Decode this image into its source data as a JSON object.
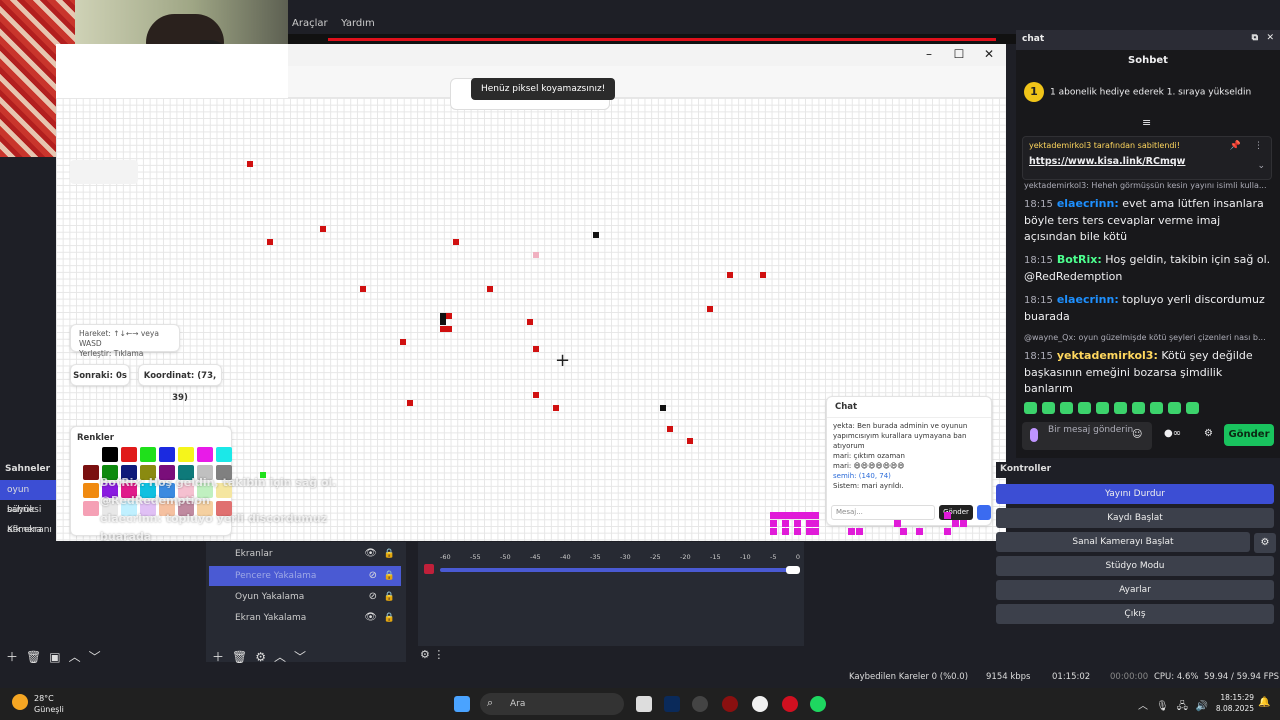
{
  "obs": {
    "menu": [
      "Araçlar",
      "Yardım"
    ],
    "scenes_title": "Sahneler",
    "scenes": [
      "oyun sahnesi",
      "büyük Kamera",
      "afk ekranı"
    ],
    "sources": [
      {
        "label": "Ekranlar",
        "visible": true
      },
      {
        "label": "Pencere Yakalama",
        "visible": false,
        "selected": true
      },
      {
        "label": "Oyun Yakalama",
        "visible": false
      },
      {
        "label": "Ekran Yakalama",
        "visible": true
      }
    ],
    "mixer_scale": [
      "-60",
      "-55",
      "-50",
      "-45",
      "-40",
      "-35",
      "-30",
      "-25",
      "-20",
      "-15",
      "-10",
      "-5",
      "0"
    ],
    "controls_title": "Kontroller",
    "controls": [
      "Yayını Durdur",
      "Kaydı Başlat",
      "Sanal Kamerayı Başlat",
      "Stüdyo Modu",
      "Ayarlar",
      "Çıkış"
    ],
    "status": {
      "dropped": "Kaybedilen Kareler 0 (%0.0)",
      "bitrate": "9154 kbps",
      "live_time": "01:15:02",
      "rec_time": "00:00:00",
      "cpu": "CPU: 4.6%",
      "fps": "59.94 / 59.94 FPS"
    }
  },
  "game": {
    "tooltip": "Henüz piksel koyamazsınız!",
    "help_line1": "Hareket: ↑↓←→ veya WASD",
    "help_line2": "Yerleştir: Tıklama",
    "cooldown": "Sonraki: 0s",
    "coordinate": "Koordinat: (73, 39)",
    "colors_title": "Renkler",
    "colors": [
      "#ffffff",
      "#000000",
      "#e01b1b",
      "#1fe01b",
      "#1b2ae0",
      "#f5f51b",
      "#e81be8",
      "#1be8e8",
      "#7a1010",
      "#0e8a0e",
      "#0e1a7a",
      "#8a8a10",
      "#7a0e7a",
      "#0e7a7a",
      "#c0c0c0",
      "#808080",
      "#f08a10",
      "#8a1be0",
      "#e01b8a",
      "#10c0e0",
      "#3b8ae0",
      "#f5c0d0",
      "#c0f0c0",
      "#f5e6a0",
      "#f5a0b5",
      "#e8e8e8",
      "#c0f0ff",
      "#e0c0f5",
      "#f5c0a0",
      "#c08aa0",
      "#f5d0a0",
      "#e07070"
    ],
    "ghost_line1": "BotRix: Hoş geldin, takibin için sağ ol.",
    "ghost_line2": "@RedRedemption",
    "ghost_line3": "elaecrinn: topluyo yerli discordumuz buarada",
    "chat_title": "Chat",
    "chat_lines": [
      "yekta: Ben burada adminin ve oyunun yapımcısıyım kurallara uymayana ban atıyorum",
      "mari: çıktım ozaman",
      "mari: 😄😄😄😄😄😄😄",
      "semih: (140, 74)",
      "Sistem: mari ayrıldı."
    ],
    "chat_placeholder": "Mesaj...",
    "chat_send": "Gönder"
  },
  "twitch": {
    "dock_title": "chat",
    "header": "Sohbet",
    "gift_num": "1",
    "gift_text": "1 abonelik hediye ederek 1. sıraya yükseldin",
    "pinned_by": "yektademirkol3 tarafından sabitlendi!",
    "pinned_link": "https://www.kisa.link/RCmqw",
    "msgs": [
      {
        "small": true,
        "text": "yektademirkol3: Heheh görmüşsün kesin yayını isimli kulla..."
      },
      {
        "time": "18:15",
        "user": "elaecrinn:",
        "cls": "u-blue",
        "text": " evet ama lütfen insanlara böyle ters ters cevaplar verme imaj açısından bile kötü"
      },
      {
        "time": "18:15",
        "user": "BotRix:",
        "cls": "u-green",
        "text": " Hoş geldin, takibin için sağ ol. @RedRedemption"
      },
      {
        "time": "18:15",
        "user": "elaecrinn:",
        "cls": "u-blue",
        "text": " topluyo yerli discordumuz buarada"
      },
      {
        "small": true,
        "text": "@wayne_Qx: oyun güzelmişde kötü şeyleri çizenleri nası b..."
      },
      {
        "time": "18:15",
        "user": "yektademirkol3:",
        "cls": "u-yellow",
        "text": " Kötü şey değilde başkasının emeğini bozarsa şimdilik banlarım"
      }
    ],
    "input_placeholder": "Bir mesaj gönderin",
    "send": "Gönder"
  },
  "taskbar": {
    "temp": "28°C",
    "weather": "Güneşli",
    "search": "Ara",
    "time": "18:15:29",
    "date": "8.08.2025"
  }
}
